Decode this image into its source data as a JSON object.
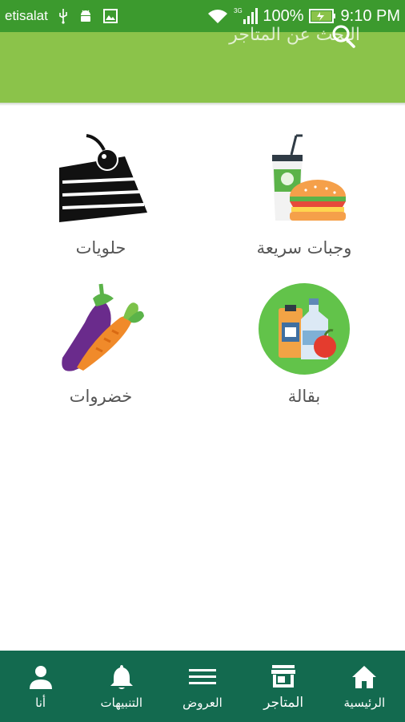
{
  "status_bar": {
    "carrier": "etisalat",
    "network": "3G",
    "battery": "100%",
    "time": "9:10 PM"
  },
  "search": {
    "placeholder": "البحث عن المتاجر"
  },
  "categories": [
    {
      "label": "وجبات سريعة",
      "icon": "fast-food-icon"
    },
    {
      "label": "حلويات",
      "icon": "cake-icon"
    },
    {
      "label": "بقالة",
      "icon": "grocery-icon"
    },
    {
      "label": "خضروات",
      "icon": "vegetables-icon"
    }
  ],
  "bottom_nav": {
    "items": [
      {
        "label": "الرئيسية",
        "icon": "home-icon"
      },
      {
        "label": "المتاجر",
        "icon": "store-icon",
        "active": true
      },
      {
        "label": "العروض",
        "icon": "menu-lines-icon"
      },
      {
        "label": "التنبيهات",
        "icon": "bell-icon"
      },
      {
        "label": "أنا",
        "icon": "person-icon"
      }
    ]
  },
  "colors": {
    "status_bar": "#3c9a2e",
    "header": "#8bc34a",
    "bottom_nav": "#136a4f"
  }
}
